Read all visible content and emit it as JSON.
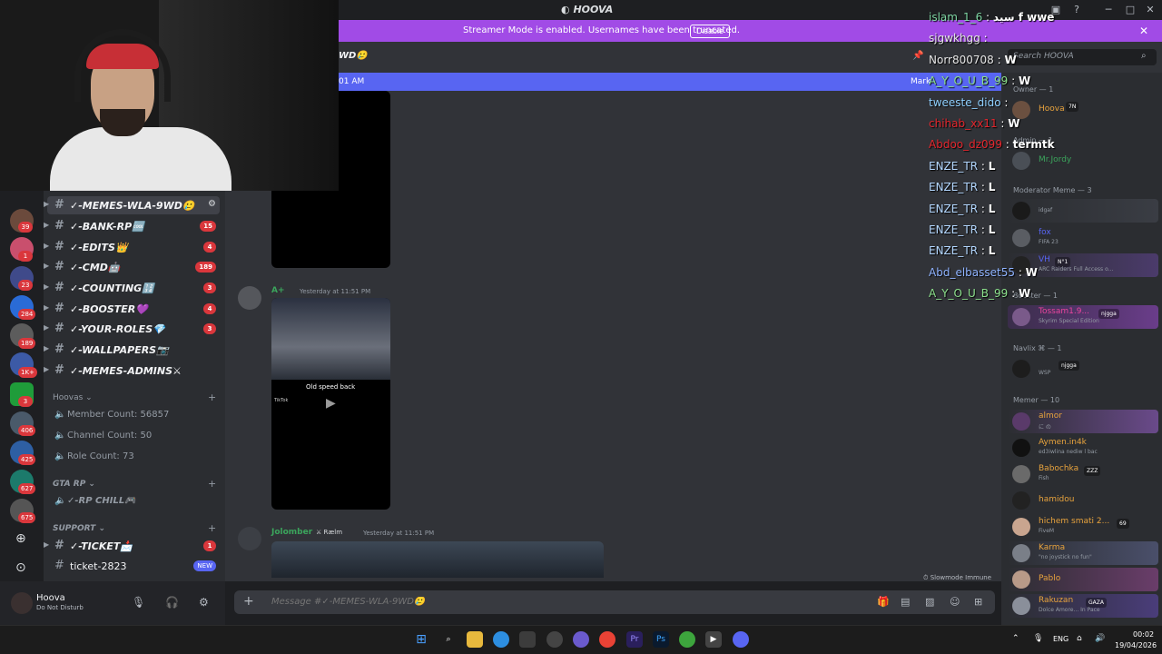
{
  "app": {
    "title": "HOOVA"
  },
  "banner": {
    "text": "Streamer Mode is enabled. Usernames have been truncated.",
    "button": "Disable"
  },
  "header": {
    "channel": "WD🥲",
    "search_placeholder": "Search HOOVA"
  },
  "new_bar": {
    "left_text": "01 AM",
    "right_text": "Mark"
  },
  "servers": [
    {
      "badge": "39",
      "color": "#6b4a3c"
    },
    {
      "badge": "1",
      "color": "#c94f6d"
    },
    {
      "badge": "23",
      "color": "#3f4a8a"
    },
    {
      "badge": "284",
      "color": "#2a6bd6"
    },
    {
      "badge": "189",
      "color": "#5c5c5c"
    },
    {
      "badge": "1K+",
      "color": "#3c5aa6"
    },
    {
      "badge": "3",
      "color": "#1f9c3a"
    },
    {
      "badge": "406",
      "color": "#4a5a6a"
    },
    {
      "badge": "425",
      "color": "#2e5fa3"
    },
    {
      "badge": "627",
      "color": "#1c7a6b"
    },
    {
      "badge": "675",
      "color": "#555555"
    }
  ],
  "channels": [
    {
      "name": "✓-MEMES-WLA-9WD🥲",
      "badge": ""
    },
    {
      "name": "✓-BANK-RP🆒",
      "badge": "15"
    },
    {
      "name": "✓-EDITS👑",
      "badge": "4"
    },
    {
      "name": "✓-CMD🤖",
      "badge": "189"
    },
    {
      "name": "✓-COUNTING🔢",
      "badge": "3"
    },
    {
      "name": "✓-BOOSTER💜",
      "badge": "4"
    },
    {
      "name": "✓-YOUR-ROLES💎",
      "badge": "3"
    },
    {
      "name": "✓-WALLPAPERS📷",
      "badge": ""
    },
    {
      "name": "✓-MEMES-ADMINS⚔",
      "badge": ""
    }
  ],
  "voice_category": "Hoovas",
  "voice_channels": [
    "Member Count: 56857",
    "Channel Count: 50",
    "Role Count: 73"
  ],
  "gta_category": "GTA RP",
  "gta_voice": "✓-RP CHILL🎮",
  "support_category": "SUPPORT",
  "support_channels": [
    {
      "name": "✓-TICKET📩",
      "badge": "1"
    },
    {
      "name": "ticket-2823",
      "badge": "NEW"
    }
  ],
  "user": {
    "name": "Hoova",
    "status": "Do Not Disturb"
  },
  "messages": [
    {
      "author": "A+",
      "author_color": "#3ba55c",
      "time": "Yesterday at 11:51 PM",
      "caption": "Old speed back",
      "tiktok": "TikTok"
    },
    {
      "author": "Jolomber",
      "author_color": "#3ba55c",
      "tag": "Rælm",
      "time": "Yesterday at 11:51 PM"
    }
  ],
  "slowmode": "Slowmode Immune",
  "composer": {
    "placeholder": "Message #✓-MEMES-WLA-9WD🥲"
  },
  "roles": [
    {
      "label": "Owner — 1"
    },
    {
      "label": "Admin — 1"
    },
    {
      "label": "Moderator Meme — 3"
    },
    {
      "label": "Booster — 1"
    },
    {
      "label": "Navlix ⌘ — 1"
    },
    {
      "label": "Memer — 10"
    }
  ],
  "members": [
    {
      "name": "Hoova",
      "color": "#e8a33d",
      "activity": "",
      "tag": "7N"
    },
    {
      "name": "Mr.Jordy",
      "color": "#3ba55c",
      "activity": "",
      "tag": ""
    },
    {
      "name": "",
      "color": "#3ba55c",
      "activity": "idgaf",
      "tag": ""
    },
    {
      "name": "fox",
      "color": "#5865f2",
      "activity": "FIFA 23",
      "tag": ""
    },
    {
      "name": "VH",
      "color": "#5865f2",
      "activity": "ARC Raiders Full Access o...",
      "tag": "N°1"
    },
    {
      "name": "Tossam1.9...",
      "color": "#eb459e",
      "activity": "Skyrim Special Edition",
      "tag": "njgga"
    },
    {
      "name": "",
      "color": "#5865f2",
      "activity": "WSP",
      "tag": "njgga"
    },
    {
      "name": "almor",
      "color": "#e8a33d",
      "activity": "に の",
      "tag": ""
    },
    {
      "name": "Aymen.in4k",
      "color": "#e8a33d",
      "activity": "ed3iwlina nediw l bac",
      "tag": ""
    },
    {
      "name": "Babochka",
      "color": "#e8a33d",
      "activity": "Fish",
      "tag": "ZZZ"
    },
    {
      "name": "hamidou",
      "color": "#e8a33d",
      "activity": "",
      "tag": ""
    },
    {
      "name": "hichem smati 2...",
      "color": "#e8a33d",
      "activity": "FiveM",
      "tag": "69"
    },
    {
      "name": "Karma",
      "color": "#e8a33d",
      "activity": "\"no joystick no fun\"",
      "tag": ""
    },
    {
      "name": "Pablo",
      "color": "#e8a33d",
      "activity": "",
      "tag": ""
    },
    {
      "name": "Rakuzan",
      "color": "#e8a33d",
      "activity": "Dolce Amore... In Pace",
      "tag": "GAZA"
    }
  ],
  "stream_chat": [
    {
      "user": "islam_1_6",
      "color": "#7fd6a4",
      "msg": "سيد f wwe"
    },
    {
      "user": "sjgwkhgg",
      "color": "#e6e6e6",
      "msg": ""
    },
    {
      "user": "Norr800708",
      "color": "#e6e6e6",
      "msg": "W"
    },
    {
      "user": "A_Y_O_U_B_99",
      "color": "#8ce08c",
      "msg": "W"
    },
    {
      "user": "tweeste_dido",
      "color": "#8fd0ff",
      "msg": ""
    },
    {
      "user": "chihab_xx11",
      "color": "#e3262d",
      "msg": "W"
    },
    {
      "user": "Abdoo_dz099",
      "color": "#e3262d",
      "msg": "termtk"
    },
    {
      "user": "ENZE_TR",
      "color": "#b3d7ff",
      "msg": "L"
    },
    {
      "user": "ENZE_TR",
      "color": "#b3d7ff",
      "msg": "L"
    },
    {
      "user": "ENZE_TR",
      "color": "#b3d7ff",
      "msg": "L"
    },
    {
      "user": "ENZE_TR",
      "color": "#b3d7ff",
      "msg": "L"
    },
    {
      "user": "ENZE_TR",
      "color": "#b3d7ff",
      "msg": "L"
    },
    {
      "user": "Abd_elbasset55",
      "color": "#8fb3ff",
      "msg": "W"
    },
    {
      "user": "A_Y_O_U_B_99",
      "color": "#8ce08c",
      "msg": "W"
    }
  ],
  "taskbar": {
    "lang": "ENG",
    "time": "00:02",
    "date": "19/04/2026"
  }
}
